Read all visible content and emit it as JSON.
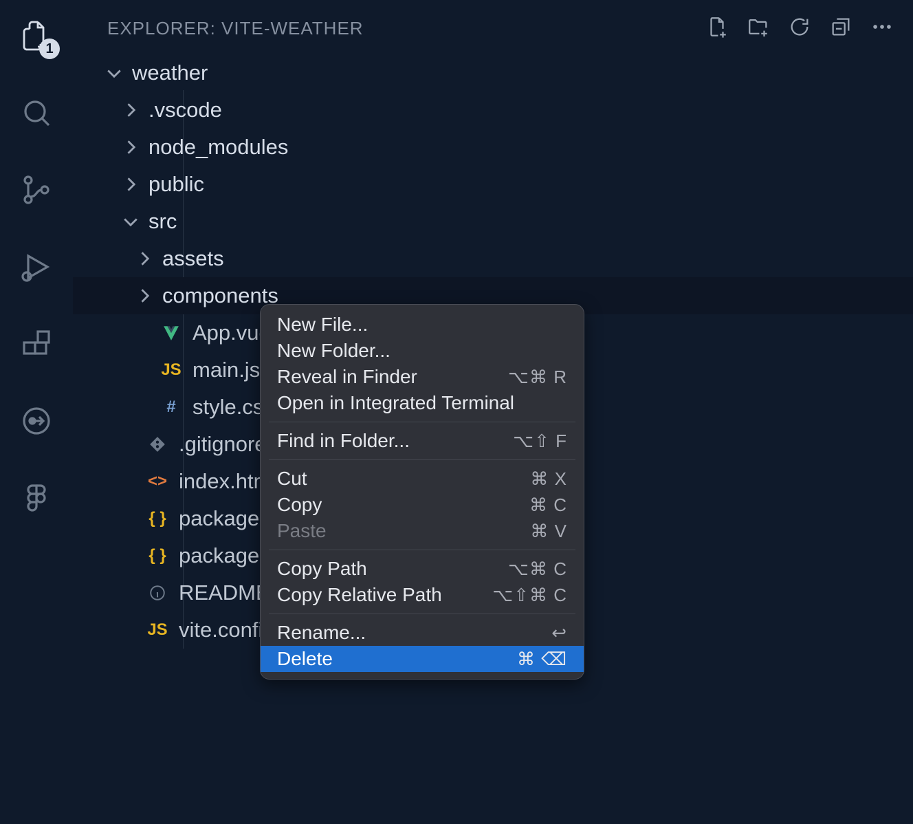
{
  "activity": {
    "explorer_badge": "1"
  },
  "sidebar": {
    "title": "EXPLORER: VITE-WEATHER",
    "tree": {
      "root": "weather",
      "folders_d1": [
        ".vscode",
        "node_modules",
        "public"
      ],
      "src_label": "src",
      "src_children_folders": [
        "assets",
        "components"
      ],
      "src_files": [
        {
          "icon": "vue",
          "name": "App.vue"
        },
        {
          "icon": "js",
          "name": "main.js"
        },
        {
          "icon": "css",
          "name": "style.css"
        }
      ],
      "root_files": [
        {
          "icon": "git",
          "name": ".gitignore"
        },
        {
          "icon": "html",
          "name": "index.html"
        },
        {
          "icon": "json",
          "name": "package-lock.json"
        },
        {
          "icon": "json",
          "name": "package.json"
        },
        {
          "icon": "info",
          "name": "README.md"
        },
        {
          "icon": "js",
          "name": "vite.config.js"
        }
      ]
    }
  },
  "context_menu": {
    "groups": [
      [
        {
          "label": "New File...",
          "shortcut": "",
          "disabled": false
        },
        {
          "label": "New Folder...",
          "shortcut": "",
          "disabled": false
        },
        {
          "label": "Reveal in Finder",
          "shortcut": "⌥⌘ R",
          "disabled": false
        },
        {
          "label": "Open in Integrated Terminal",
          "shortcut": "",
          "disabled": false
        }
      ],
      [
        {
          "label": "Find in Folder...",
          "shortcut": "⌥⇧ F",
          "disabled": false
        }
      ],
      [
        {
          "label": "Cut",
          "shortcut": "⌘ X",
          "disabled": false
        },
        {
          "label": "Copy",
          "shortcut": "⌘ C",
          "disabled": false
        },
        {
          "label": "Paste",
          "shortcut": "⌘ V",
          "disabled": true
        }
      ],
      [
        {
          "label": "Copy Path",
          "shortcut": "⌥⌘ C",
          "disabled": false
        },
        {
          "label": "Copy Relative Path",
          "shortcut": "⌥⇧⌘ C",
          "disabled": false
        }
      ],
      [
        {
          "label": "Rename...",
          "shortcut": "↩",
          "disabled": false
        },
        {
          "label": "Delete",
          "shortcut": "⌘ ⌫",
          "disabled": false,
          "highlight": true
        }
      ]
    ]
  }
}
